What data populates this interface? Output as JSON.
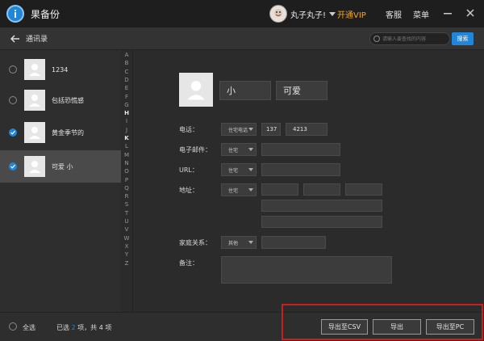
{
  "app": {
    "title": "果备份"
  },
  "header": {
    "username": "丸子丸子!",
    "vip": "开通VIP",
    "service": "客服",
    "menu": "菜单"
  },
  "subbar": {
    "title": "通讯录",
    "search_placeholder": "请输入要查找的内容",
    "search_button": "搜索"
  },
  "contacts": [
    {
      "name": "1234",
      "checked": false,
      "selected": false
    },
    {
      "name": "包括恐慌感",
      "checked": false,
      "selected": false
    },
    {
      "name": "黄金季节的",
      "checked": true,
      "selected": false
    },
    {
      "name": "可爱 小",
      "checked": true,
      "selected": true
    }
  ],
  "alphabet": [
    "A",
    "B",
    "C",
    "D",
    "E",
    "F",
    "G",
    "H",
    "I",
    "J",
    "K",
    "L",
    "M",
    "N",
    "O",
    "P",
    "Q",
    "R",
    "S",
    "T",
    "U",
    "V",
    "W",
    "X",
    "Y",
    "Z"
  ],
  "alphabet_active": [
    "H",
    "K"
  ],
  "detail": {
    "first_name": "小",
    "last_name": "可爱",
    "labels": {
      "phone": "电话：",
      "email": "电子邮件：",
      "url": "URL：",
      "address": "地址：",
      "family": "家庭关系：",
      "note": "备注："
    },
    "phone_type": "住宅电话",
    "phone_part1": "137",
    "phone_part2": "4213",
    "email_type": "住宅",
    "url_type": "住宅",
    "address_type": "住宅",
    "family_type": "其他"
  },
  "footer": {
    "select_all": "全选",
    "count_prefix": "已选 ",
    "count_selected": "2",
    "count_suffix": " 项，共 4 项",
    "export_csv": "导出至CSV",
    "export": "导出",
    "export_to_pc": "导出至PC"
  },
  "colors": {
    "accent": "#1f86d8",
    "vip": "#f5a623",
    "highlight_box": "#c8201e"
  }
}
